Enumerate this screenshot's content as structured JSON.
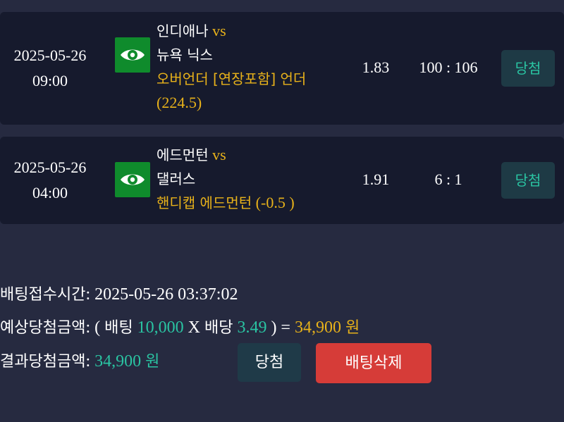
{
  "bets": [
    {
      "date": "2025-05-26",
      "time": "09:00",
      "home": "인디애나",
      "vs": "vs",
      "away": "뉴욕 닉스",
      "market": "오버언더 [연장포함] 언더",
      "market_line": "(224.5)",
      "odds": "1.83",
      "score": "100 : 106",
      "result": "당첨"
    },
    {
      "date": "2025-05-26",
      "time": "04:00",
      "home": "에드먼턴",
      "vs": "vs",
      "away": "댈러스",
      "market": "핸디캡 에드먼턴",
      "market_line": "(-0.5 )",
      "odds": "1.91",
      "score": "6 : 1",
      "result": "당첨"
    }
  ],
  "summary": {
    "bet_time_label": "배팅접수시간",
    "bet_time_sep": ": ",
    "bet_time_value": "2025-05-26 03:37:02",
    "expected_label": "예상당첨금액",
    "expected_open": ": ( ",
    "bet_word": "배팅",
    "bet_amount": "10,000",
    "times": "X",
    "odds_word": "배당",
    "total_odds": "3.49",
    "close_eq": ") =",
    "expected_amount": "34,900",
    "won": "원",
    "result_label": "결과당첨금액",
    "result_sep": ": ",
    "result_amount": "34,900",
    "result_won": "원"
  },
  "buttons": {
    "win_label": "당첨",
    "delete_label": "배팅삭제"
  },
  "icons": [
    "eye-icon"
  ],
  "colors": {
    "background": "#262a40",
    "card": "#161a2d",
    "accent_gold": "#e8b21a",
    "accent_teal": "#2ac4a2",
    "eye_green": "#0f8b2c",
    "delete_red": "#d63c38"
  }
}
